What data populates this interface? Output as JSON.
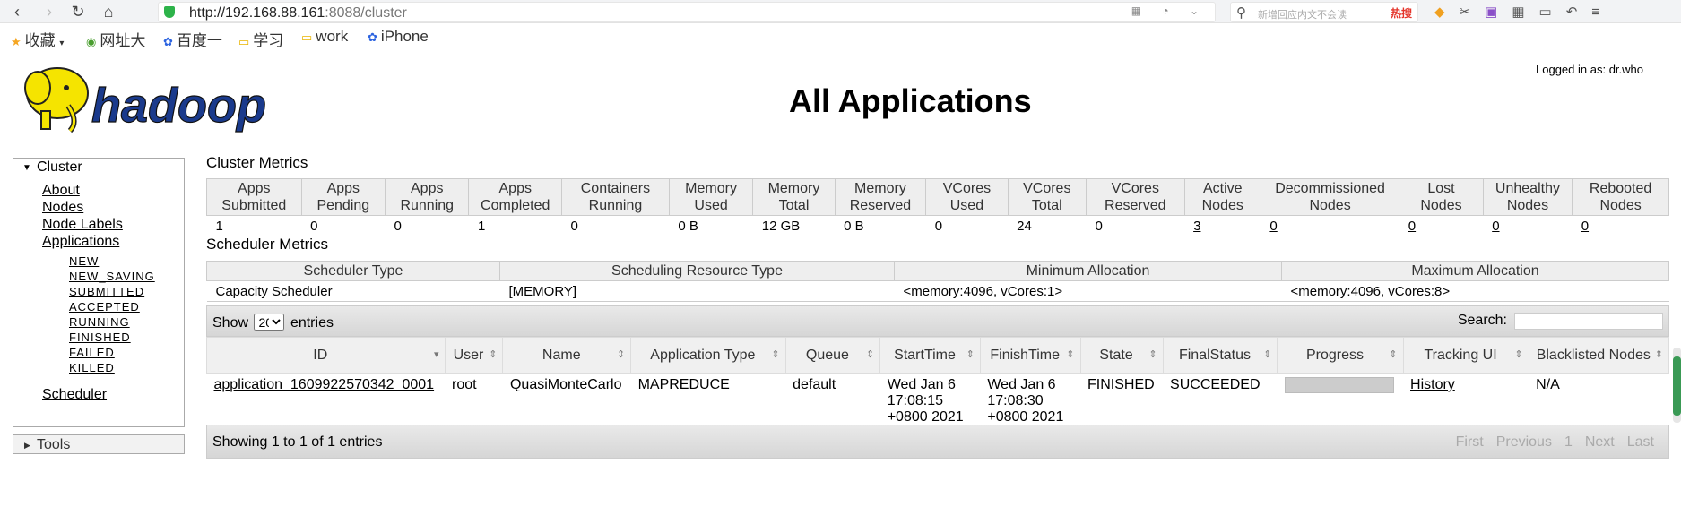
{
  "browser": {
    "url_host": "http://192.168.88.161",
    "url_rest": ":8088/cluster",
    "search_placeholder": "新增回应内文不会读",
    "search_hot": "热搜",
    "bookmarks": [
      "收藏",
      "网址大",
      "百度一",
      "学习",
      "work",
      "iPhone"
    ]
  },
  "header": {
    "logged_in": "Logged in as: dr.who",
    "title": "All Applications",
    "logo_text": "hadoop"
  },
  "sidebar": {
    "cluster_label": "Cluster",
    "links": [
      "About",
      "Nodes",
      "Node Labels",
      "Applications"
    ],
    "app_states": [
      "NEW",
      "NEW_SAVING",
      "SUBMITTED",
      "ACCEPTED",
      "RUNNING",
      "FINISHED",
      "FAILED",
      "KILLED"
    ],
    "scheduler_label": "Scheduler",
    "tools_label": "Tools"
  },
  "cluster_metrics": {
    "title": "Cluster Metrics",
    "headers": [
      [
        "Apps",
        "Submitted"
      ],
      [
        "Apps",
        "Pending"
      ],
      [
        "Apps",
        "Running"
      ],
      [
        "Apps",
        "Completed"
      ],
      [
        "Containers",
        "Running"
      ],
      [
        "Memory",
        "Used"
      ],
      [
        "Memory",
        "Total"
      ],
      [
        "Memory",
        "Reserved"
      ],
      [
        "VCores",
        "Used"
      ],
      [
        "VCores",
        "Total"
      ],
      [
        "VCores",
        "Reserved"
      ],
      [
        "Active",
        "Nodes"
      ],
      [
        "Decommissioned",
        "Nodes"
      ],
      [
        "Lost",
        "Nodes"
      ],
      [
        "Unhealthy",
        "Nodes"
      ],
      [
        "Rebooted",
        "Nodes"
      ]
    ],
    "values": [
      "1",
      "0",
      "0",
      "1",
      "0",
      "0 B",
      "12 GB",
      "0 B",
      "0",
      "24",
      "0",
      "3",
      "0",
      "0",
      "0",
      "0"
    ]
  },
  "scheduler_metrics": {
    "title": "Scheduler Metrics",
    "headers": [
      "Scheduler Type",
      "Scheduling Resource Type",
      "Minimum Allocation",
      "Maximum Allocation"
    ],
    "values": [
      "Capacity Scheduler",
      "[MEMORY]",
      "<memory:4096, vCores:1>",
      "<memory:4096, vCores:8>"
    ]
  },
  "apps_table": {
    "show_label": "Show",
    "page_size": "20",
    "entries_label": "entries",
    "search_label": "Search:",
    "headers": [
      "ID",
      "User",
      "Name",
      "Application Type",
      "Queue",
      "StartTime",
      "FinishTime",
      "State",
      "FinalStatus",
      "Progress",
      "Tracking UI",
      "Blacklisted Nodes"
    ],
    "row": {
      "id": "application_1609922570342_0001",
      "user": "root",
      "name": "QuasiMonteCarlo",
      "type": "MAPREDUCE",
      "queue": "default",
      "start": [
        "Wed Jan 6",
        "17:08:15",
        "+0800 2021"
      ],
      "finish": [
        "Wed Jan 6",
        "17:08:30",
        "+0800 2021"
      ],
      "state": "FINISHED",
      "final_status": "SUCCEEDED",
      "progress": 1.0,
      "tracking": "History",
      "blacklisted": "N/A"
    },
    "info": "Showing 1 to 1 of 1 entries",
    "pager": [
      "First",
      "Previous",
      "1",
      "Next",
      "Last"
    ]
  },
  "colors": {
    "progress_fill": "#cccccc",
    "scrollbar": "#3a9a55",
    "logo_blue": "#1a3a8c",
    "logo_yellow": "#f5e400"
  }
}
